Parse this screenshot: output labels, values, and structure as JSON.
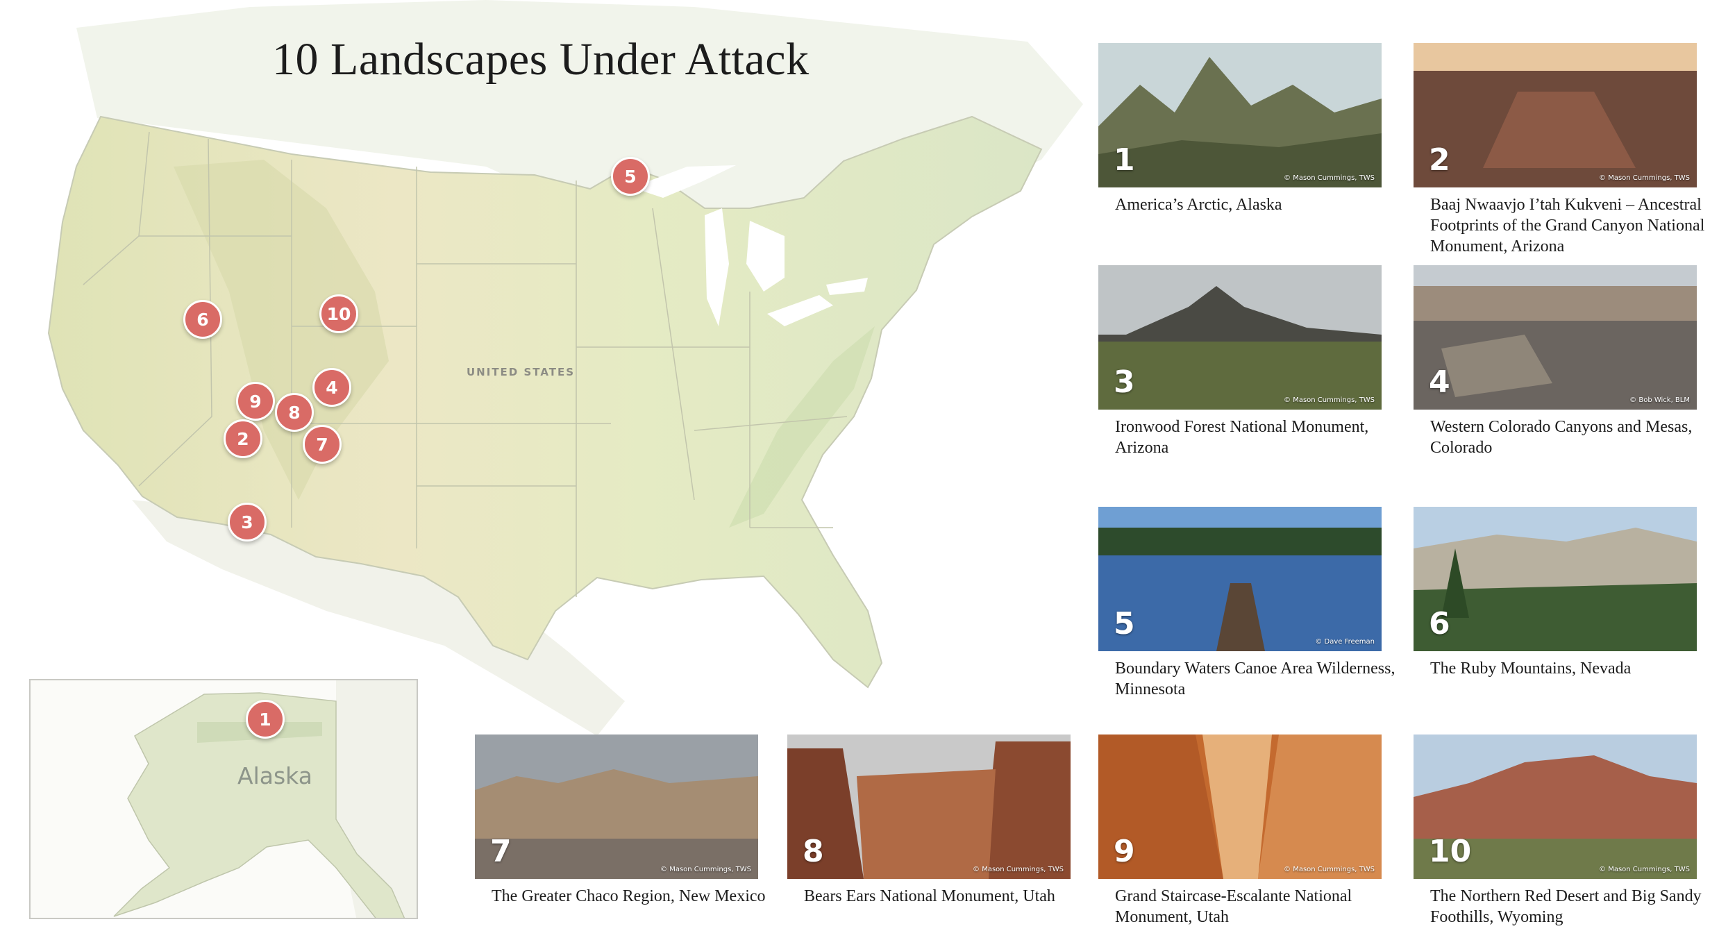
{
  "title": "10 Landscapes Under Attack",
  "map": {
    "country_label": "UNITED STATES",
    "inset_label": "Alaska",
    "colors": {
      "marker": "#d96b66",
      "land": "#e6e7c4",
      "water": "#ffffff"
    },
    "markers": [
      "1",
      "2",
      "3",
      "4",
      "5",
      "6",
      "7",
      "8",
      "9",
      "10"
    ]
  },
  "places": [
    {
      "number": "1",
      "caption": "America’s Arctic, Alaska",
      "credit": "© Mason Cummings, TWS"
    },
    {
      "number": "2",
      "caption": "Baaj Nwaavjo I’tah Kukveni – Ancestral Footprints of the Grand Canyon National Monument, Arizona",
      "credit": "© Mason Cummings, TWS"
    },
    {
      "number": "3",
      "caption": "Ironwood Forest National Monument, Arizona",
      "credit": "© Mason Cummings, TWS"
    },
    {
      "number": "4",
      "caption": "Western Colorado Canyons and Mesas, Colorado",
      "credit": "© Bob Wick, BLM"
    },
    {
      "number": "5",
      "caption": "Boundary Waters Canoe Area Wilderness, Minnesota",
      "credit": "© Dave Freeman"
    },
    {
      "number": "6",
      "caption": "The Ruby Mountains, Nevada",
      "credit": ""
    },
    {
      "number": "7",
      "caption": "The Greater Chaco Region, New Mexico",
      "credit": "© Mason Cummings, TWS"
    },
    {
      "number": "8",
      "caption": "Bears Ears National Monument, Utah",
      "credit": "© Mason Cummings, TWS"
    },
    {
      "number": "9",
      "caption": "Grand Staircase-Escalante National Monument, Utah",
      "credit": "© Mason Cummings, TWS"
    },
    {
      "number": "10",
      "caption": "The Northern Red Desert and Big Sandy Foothills, Wyoming",
      "credit": "© Mason Cummings, TWS"
    }
  ]
}
